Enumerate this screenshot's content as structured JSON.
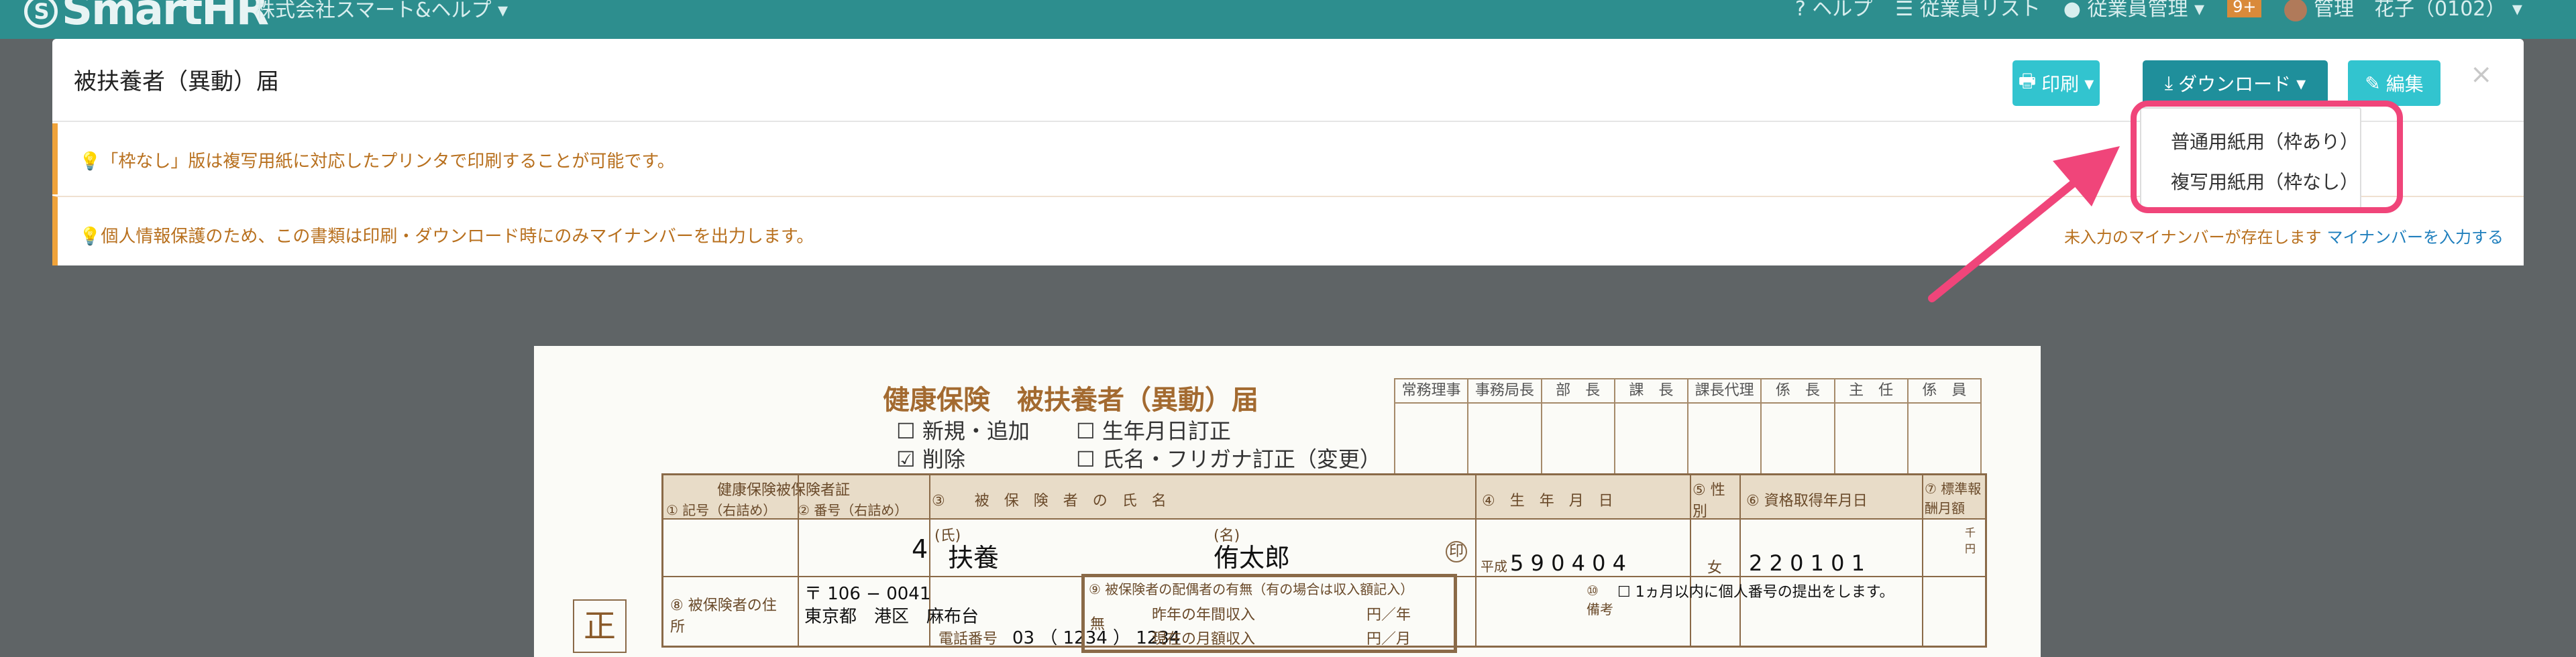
{
  "topbar": {
    "logo": "SmartHR",
    "logo_mark": "S",
    "company": "株式会社スマート&ヘルプ",
    "help": "ヘルプ",
    "employee_list": "従業員リスト",
    "employee_mgmt": "従業員管理",
    "badge": "9+",
    "user": "管理　花子（0102）"
  },
  "modal": {
    "title": "被扶養者（異動）届",
    "print_label": "印刷",
    "download_label": "ダウンロード",
    "edit_label": "編集",
    "close": "×"
  },
  "notices": {
    "n1": "「枠なし」版は複写用紙に対応したプリンタで印刷することが可能です。",
    "n2": "個人情報保護のため、この書類は印刷・ダウンロード時にのみマイナンバーを出力します。",
    "mynumber_missing": "未入力のマイナンバーが存在します",
    "mynumber_link": "マイナンバーを入力する"
  },
  "dropdown": {
    "items": [
      "普通用紙用（枠あり）",
      "複写用紙用（枠なし）"
    ]
  },
  "document": {
    "title": "健康保険　被扶養者（異動）届",
    "opt_new": "☐ 新規・追加",
    "opt_delete": "☑ 削除",
    "opt_birth": "☐ 生年月日訂正",
    "opt_name": "☐ 氏名・フリガナ訂正（変更）",
    "approvals": [
      "常務理事",
      "事務局長",
      "部　長",
      "課　長",
      "課長代理",
      "係　長",
      "主　任",
      "係　員"
    ],
    "h_card": "健康保険被保険者証",
    "h_mark": "① 記号（右詰め）",
    "h_num": "② 番号（右詰め）",
    "h_name": "③　　被　保　険　者　の　氏　名",
    "h_birth": "④　生　年　月　日",
    "h_sex": "⑤ 性別",
    "h_acq": "⑥ 資格取得年月日",
    "h_std": "⑦ 標準報酬月額",
    "num_val": "4",
    "sei_label": "(氏)",
    "sei": "扶養",
    "mei_label": "(名)",
    "mei": "侑太郎",
    "seal": "印",
    "era": "平成",
    "birth": "5 9 0 4 0 4",
    "sex": "女",
    "acq": "2 2 0 1 0 1",
    "unit": "千円",
    "addr_label": "⑧ 被保険者の住所",
    "zip": "〒 106 − 0041",
    "address": "東京都　港区　麻布台",
    "tel_label": "電話番号",
    "tel": "03 （ 1234 ） 1234",
    "spouse_title": "⑨ 被保険者の配偶者の有無（有の場合は収入額記入）",
    "spouse_none": "無",
    "spouse_y": "昨年の年間収入",
    "spouse_y_unit": "円／年",
    "spouse_m": "現在の月額収入",
    "spouse_m_unit": "円／月",
    "remarks": "⑩ 備考",
    "remarks_text": "☐ 1ヵ月以内に個人番号の提出をします。",
    "copy_mark": "正"
  }
}
